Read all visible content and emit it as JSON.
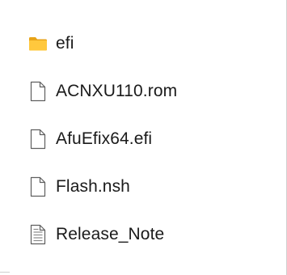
{
  "explorer": {
    "items": [
      {
        "name": "efi",
        "type": "folder",
        "icon": "folder-icon"
      },
      {
        "name": "ACNXU110.rom",
        "type": "file",
        "icon": "file-icon"
      },
      {
        "name": "AfuEfix64.efi",
        "type": "file",
        "icon": "file-icon"
      },
      {
        "name": "Flash.nsh",
        "type": "file",
        "icon": "file-icon"
      },
      {
        "name": "Release_Note",
        "type": "text-file",
        "icon": "text-file-icon"
      }
    ]
  },
  "colors": {
    "folder_body": "#ffc83d",
    "folder_tab": "#e8a317",
    "file_outline": "#5f5f5f",
    "text_lines": "#8a8a8a"
  }
}
